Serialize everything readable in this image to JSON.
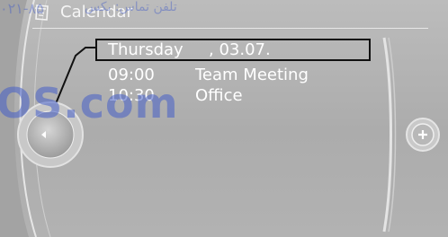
{
  "header": {
    "title": "Calendar",
    "icon": "calendar-icon"
  },
  "selected_day": {
    "weekday": "Thursday",
    "date": ", 03.07."
  },
  "events": [
    {
      "time": "09:00",
      "title": "Team Meeting"
    },
    {
      "time": "10:30",
      "title": "Office"
    }
  ],
  "controls": {
    "left_knob_icon": "arrow-left-icon",
    "right_knob_icon": "plus-icon"
  },
  "watermark": {
    "brand": "OS.com",
    "arabic": "تلفن تماس: بکس",
    "digits": "۰۲۱-۸۵"
  },
  "colors": {
    "screen_bg": "#b4b4b4",
    "text": "#ffffff",
    "highlight_border": "#111111",
    "watermark": "#465fc8"
  }
}
